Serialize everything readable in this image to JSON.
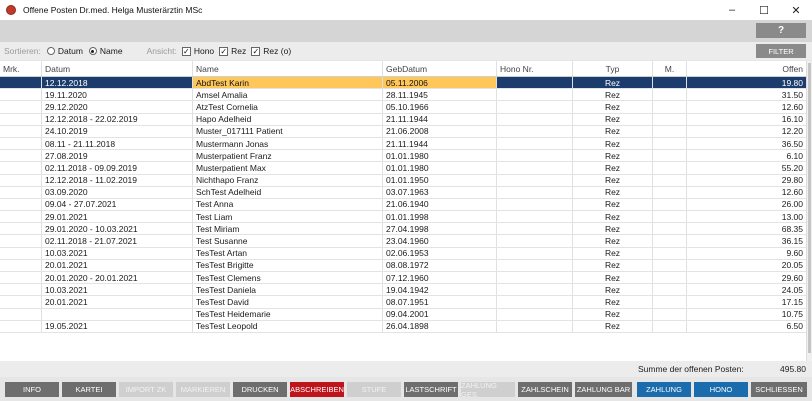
{
  "window": {
    "title": "Offene Posten Dr.med. Helga Musterärztin MSc",
    "minimize": "–",
    "maximize": "☐",
    "close": "✕"
  },
  "toolbar": {
    "help_label": "?",
    "filter_label": "FILTER"
  },
  "sort": {
    "label": "Sortieren:",
    "option_date": "Datum",
    "option_name": "Name",
    "selected": "Name"
  },
  "view": {
    "label": "Ansicht:",
    "hono": "Hono",
    "hono_checked": true,
    "rez": "Rez",
    "rez_checked": true,
    "rez_o": "Rez (o)",
    "rez_o_checked": true
  },
  "columns": {
    "mrk": "Mrk.",
    "datum": "Datum",
    "name": "Name",
    "gebdatum": "GebDatum",
    "hono_nr": "Hono Nr.",
    "typ": "Typ",
    "m": "M.",
    "offen": "Offen"
  },
  "rows": [
    {
      "datum": "12.12.2018",
      "name": "AbdTest Karin",
      "geb": "05.11.2006",
      "typ": "Rez",
      "offen": "19.80"
    },
    {
      "datum": "19.11.2020",
      "name": "Amsel Amalia",
      "geb": "28.11.1945",
      "typ": "Rez",
      "offen": "31.50"
    },
    {
      "datum": "29.12.2020",
      "name": "AtzTest Cornelia",
      "geb": "05.10.1966",
      "typ": "Rez",
      "offen": "12.60"
    },
    {
      "datum": "12.12.2018 - 22.02.2019",
      "name": "Hapo Adelheid",
      "geb": "21.11.1944",
      "typ": "Rez",
      "offen": "16.10"
    },
    {
      "datum": "24.10.2019",
      "name": "Muster_017111 Patient",
      "geb": "21.06.2008",
      "typ": "Rez",
      "offen": "12.20"
    },
    {
      "datum": "08.11 - 21.11.2018",
      "name": "Mustermann Jonas",
      "geb": "21.11.1944",
      "typ": "Rez",
      "offen": "36.50"
    },
    {
      "datum": "27.08.2019",
      "name": "Musterpatient Franz",
      "geb": "01.01.1980",
      "typ": "Rez",
      "offen": "6.10"
    },
    {
      "datum": "02.11.2018 - 09.09.2019",
      "name": "Musterpatient Max",
      "geb": "01.01.1980",
      "typ": "Rez",
      "offen": "55.20"
    },
    {
      "datum": "12.12.2018 - 11.02.2019",
      "name": "Nichthapo Franz",
      "geb": "01.01.1950",
      "typ": "Rez",
      "offen": "29.80"
    },
    {
      "datum": "03.09.2020",
      "name": "SchTest Adelheid",
      "geb": "03.07.1963",
      "typ": "Rez",
      "offen": "12.60"
    },
    {
      "datum": "09.04 - 27.07.2021",
      "name": "Test Anna",
      "geb": "21.06.1940",
      "typ": "Rez",
      "offen": "26.00"
    },
    {
      "datum": "29.01.2021",
      "name": "Test Liam",
      "geb": "01.01.1998",
      "typ": "Rez",
      "offen": "13.00"
    },
    {
      "datum": "29.01.2020 - 10.03.2021",
      "name": "Test Miriam",
      "geb": "27.04.1998",
      "typ": "Rez",
      "offen": "68.35"
    },
    {
      "datum": "02.11.2018 - 21.07.2021",
      "name": "Test Susanne",
      "geb": "23.04.1960",
      "typ": "Rez",
      "offen": "36.15"
    },
    {
      "datum": "10.03.2021",
      "name": "TesTest Artan",
      "geb": "02.06.1953",
      "typ": "Rez",
      "offen": "9.60"
    },
    {
      "datum": "20.01.2021",
      "name": "TesTest Brigitte",
      "geb": "08.08.1972",
      "typ": "Rez",
      "offen": "20.05"
    },
    {
      "datum": "20.01.2020 - 20.01.2021",
      "name": "TesTest Clemens",
      "geb": "07.12.1960",
      "typ": "Rez",
      "offen": "29.60"
    },
    {
      "datum": "10.03.2021",
      "name": "TesTest Daniela",
      "geb": "19.04.1942",
      "typ": "Rez",
      "offen": "24.05"
    },
    {
      "datum": "20.01.2021",
      "name": "TesTest David",
      "geb": "08.07.1951",
      "typ": "Rez",
      "offen": "17.15"
    },
    {
      "datum": "",
      "name": "TesTest Heidemarie",
      "geb": "09.04.2001",
      "typ": "Rez",
      "offen": "10.75"
    },
    {
      "datum": "19.05.2021",
      "name": "TesTest Leopold",
      "geb": "26.04.1898",
      "typ": "Rez",
      "offen": "6.50"
    }
  ],
  "summary": {
    "label": "Summe der offenen Posten:",
    "value": "495.80"
  },
  "footer_buttons": [
    {
      "label": "INFO",
      "enabled": true,
      "style": "gray"
    },
    {
      "label": "KARTEI",
      "enabled": true,
      "style": "gray"
    },
    {
      "label": "IMPORT ZK",
      "enabled": false,
      "style": "gray"
    },
    {
      "label": "MARKIEREN",
      "enabled": false,
      "style": "gray"
    },
    {
      "label": "DRUCKEN",
      "enabled": true,
      "style": "gray"
    },
    {
      "label": "ABSCHREIBEN",
      "enabled": true,
      "style": "red"
    },
    {
      "label": "STUFE",
      "enabled": false,
      "style": "gray"
    },
    {
      "label": "LASTSCHRIFT",
      "enabled": true,
      "style": "gray"
    },
    {
      "label": "ZAHLUNG GES.",
      "enabled": false,
      "style": "gray"
    },
    {
      "label": "ZAHLSCHEIN",
      "enabled": true,
      "style": "gray"
    },
    {
      "label": "ZAHLUNG BAR",
      "enabled": true,
      "style": "gray"
    },
    {
      "label": "ZAHLUNG",
      "enabled": true,
      "style": "blue"
    },
    {
      "label": "HONO",
      "enabled": true,
      "style": "blue"
    },
    {
      "label": "SCHLIESSEN",
      "enabled": true,
      "style": "gray"
    }
  ],
  "colors": {
    "selected_row": "#1d3c6e",
    "selected_highlight": "#ffc75a",
    "danger": "#c0141c",
    "primary": "#1b6cac"
  }
}
